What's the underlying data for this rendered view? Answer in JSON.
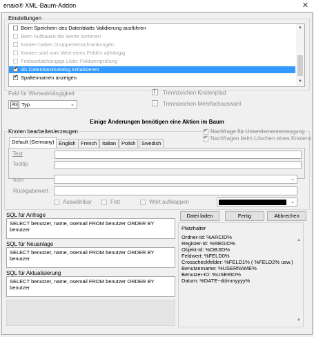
{
  "window": {
    "title": "enaio® XML-Baum-Addon",
    "close_glyph": "✕"
  },
  "settings": {
    "group_label": "Einstellungen",
    "items": [
      {
        "label": "Beim Speichern des Datenblatts Validierung ausführen",
        "checked": false,
        "enabled": true
      },
      {
        "label": "Beim Aufbauen die Werte sortieren",
        "checked": false,
        "enabled": false
      },
      {
        "label": "Knoten haben Gruppeneinschränkungen",
        "checked": false,
        "enabled": false
      },
      {
        "label": "Knoten sind vom Wert eines Feldes abhängig",
        "checked": false,
        "enabled": false
      },
      {
        "label": "Feldwertabhängige Liste: Feldwertprüfung",
        "checked": false,
        "enabled": false
      },
      {
        "label": "als Datenbankkatalog initialisieren",
        "checked": true,
        "enabled": true,
        "selected": true
      },
      {
        "label": "Spaltennamen anzeigen",
        "checked": true,
        "enabled": true
      }
    ]
  },
  "dependency": {
    "label": "Feld für Werteabhängigkeit",
    "type_icon_text": "Ab|",
    "type_value": "Typ"
  },
  "separators": {
    "node_path_label": "Trennzeichen Knotenpfad",
    "node_path_value": "|",
    "multi_select_label": "Trennzeichen Mehrfachauswahl",
    "multi_select_value": ","
  },
  "notice": "Einige Änderungen benötigen eine Aktion im Baum",
  "nodes": {
    "group_label": "Knoten bearbeiten/erzeugen",
    "option_query_subelements": "Nachfrage für Unterelementerzeugung",
    "option_query_delete": "Nachfragen beim Löschen eines Knotens",
    "tabs": [
      "Default (Germany)",
      "English",
      "French",
      "Italian",
      "Polish",
      "Swedish"
    ],
    "text_label": "Text",
    "tooltip_label": "Tooltip",
    "icon_label": "Icon",
    "return_value_label": "Rückgabewert",
    "selectable_label": "Auswählbar",
    "bold_label": "Fett",
    "expand_value_label": "Wert aufklappen",
    "color_value": "#000000"
  },
  "sql": {
    "query_label": "SQL für Anfrage",
    "query_value": "SELECT benutzer, name, osemail FROM benutzer ORDER BY benutzer",
    "create_label": "SQL für Neuanlage",
    "create_value": "SELECT benutzer, name, osemail FROM benutzer ORDER BY benutzer",
    "update_label": "SQL für Aktualisierung",
    "update_value": "SELECT benutzer, name, osemail FROM benutzer ORDER BY benutzer"
  },
  "buttons": {
    "load": "Datei laden",
    "done": "Fertig",
    "cancel": "Abbrechen"
  },
  "placeholders": {
    "title": "Platzhalter",
    "lines": [
      "Ordner-Id: %ARCID%",
      "Register-Id: %REGID%",
      "Objekt-Id: %OBJID%",
      "Feldwert: %FELD0%",
      "Crosscheckfelder: %FELD1% ( %FELD2% usw.)",
      "Benutzername: %USERNAME%",
      "Benutzer-ID: %USERID%",
      "Datum: %DATE~ddmmyyyy%"
    ]
  }
}
